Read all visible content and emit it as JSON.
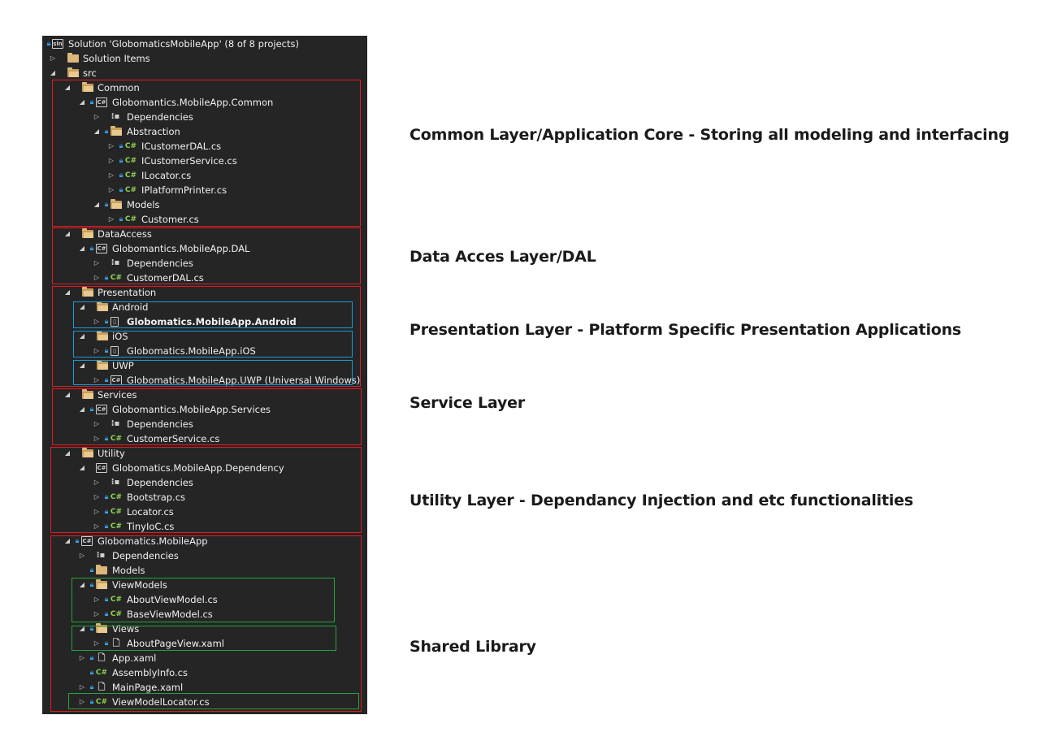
{
  "solution_explorer": {
    "solution_label": "Solution 'GlobomaticsMobileApp' (8 of 8 projects)",
    "items": {
      "solution_items": "Solution Items",
      "src": "src",
      "common": "Common",
      "common_project": "Globomantics.MobileApp.Common",
      "common_deps": "Dependencies",
      "abstraction": "Abstraction",
      "icustomerdal": "ICustomerDAL.cs",
      "icustomerservice": "ICustomerService.cs",
      "ilocator": "ILocator.cs",
      "iplatformprinter": "IPlatformPrinter.cs",
      "models": "Models",
      "customer": "Customer.cs",
      "dataaccess": "DataAccess",
      "dal_project": "Globomantics.MobileApp.DAL",
      "dal_deps": "Dependencies",
      "customerdal": "CustomerDAL.cs",
      "presentation": "Presentation",
      "android": "Android",
      "android_project": "Globomatics.MobileApp.Android",
      "ios": "iOS",
      "ios_project": "Globomatics.MobileApp.iOS",
      "uwp": "UWP",
      "uwp_project": "Globomatics.MobileApp.UWP (Universal Windows)",
      "services": "Services",
      "services_project": "Globomantics.MobileApp.Services",
      "services_deps": "Dependencies",
      "customerservice": "CustomerService.cs",
      "utility": "Utility",
      "utility_project": "Globomatics.MobileApp.Dependency",
      "utility_deps": "Dependencies",
      "bootstrap": "Bootstrap.cs",
      "locator": "Locator.cs",
      "tinyioc": "TinyIoC.cs",
      "shared_project": "Globomatics.MobileApp",
      "shared_deps": "Dependencies",
      "shared_models": "Models",
      "viewmodels": "ViewModels",
      "aboutviewmodel": "AboutViewModel.cs",
      "baseviewmodel": "BaseViewModel.cs",
      "views": "Views",
      "aboutpageview": "AboutPageView.xaml",
      "app_xaml": "App.xaml",
      "assemblyinfo": "AssemblyInfo.cs",
      "mainpage": "MainPage.xaml",
      "viewmodellocator": "ViewModelLocator.cs"
    }
  },
  "annotations": {
    "common": "Common Layer/Application Core - Storing all modeling and interfacing",
    "dal": "Data Acces Layer/DAL",
    "presentation": "Presentation Layer - Platform Specific Presentation Applications",
    "service": "Service Layer",
    "utility": "Utility Layer - Dependancy Injection and etc functionalities",
    "shared": "Shared Library"
  },
  "colors": {
    "panel_bg": "#252526",
    "layer_box": "#e01c22",
    "platform_box": "#1b9ad6",
    "mvvm_box": "#23a33c",
    "csharp_icon": "#8fd14f",
    "folder_icon": "#dcb67a"
  },
  "icons": {
    "expanded": "triangle-down-icon",
    "collapsed": "triangle-right-icon",
    "lock": "lock-icon",
    "csharp": "csharp-file-icon",
    "project": "csharp-project-icon",
    "dependencies": "dependencies-icon",
    "folder": "folder-icon",
    "xaml": "xaml-file-icon"
  }
}
